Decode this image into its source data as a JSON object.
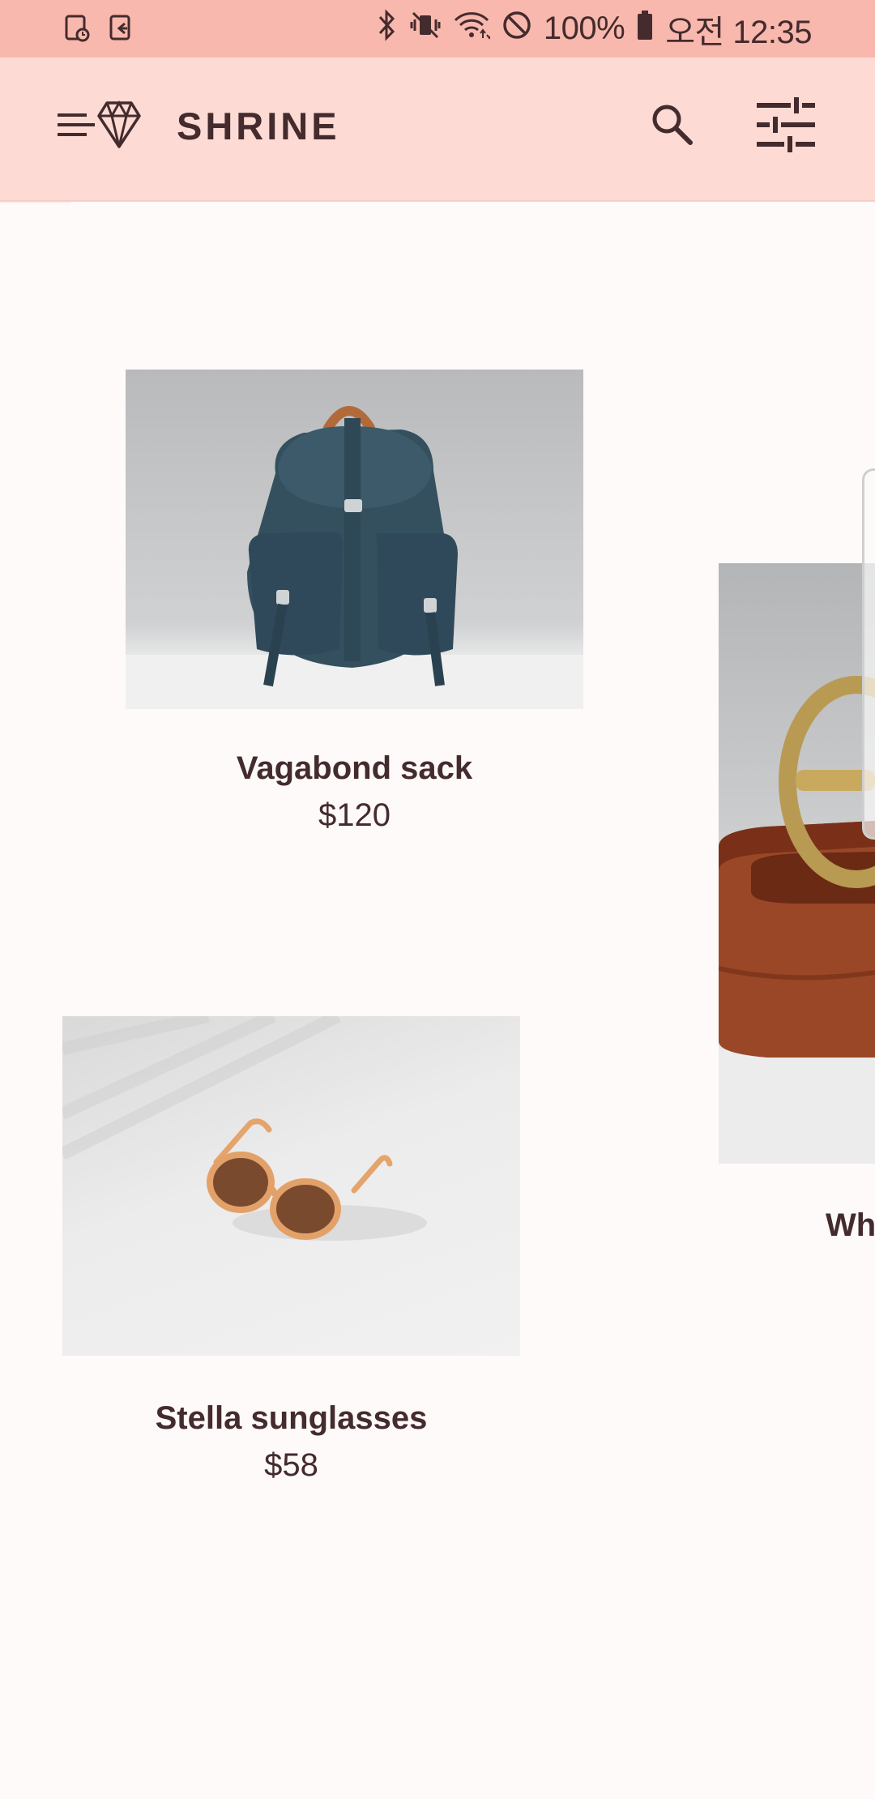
{
  "status_bar": {
    "battery_text": "100%",
    "time_text": "오전 12:35",
    "icons": [
      "screen-timer-icon",
      "exit-app-icon",
      "bluetooth-icon",
      "vibrate-off-icon",
      "wifi-icon",
      "do-not-disturb-icon",
      "battery-icon"
    ]
  },
  "app_bar": {
    "title": "SHRINE",
    "icons": [
      "menu-icon",
      "shrine-diamond-logo-icon",
      "search-icon",
      "tune-filter-icon"
    ]
  },
  "colors": {
    "status_bar_bg": "#f9b8ad",
    "app_bar_bg": "#fddbd4",
    "surface": "#fefaf9",
    "text": "#442b2d"
  },
  "products": [
    {
      "name": "Vagabond sack",
      "price": "$120",
      "image": "backpack-image"
    },
    {
      "name": "Wh",
      "price": "",
      "image": "belt-image"
    },
    {
      "name": "Stella sunglasses",
      "price": "$58",
      "image": "sunglasses-image"
    }
  ]
}
